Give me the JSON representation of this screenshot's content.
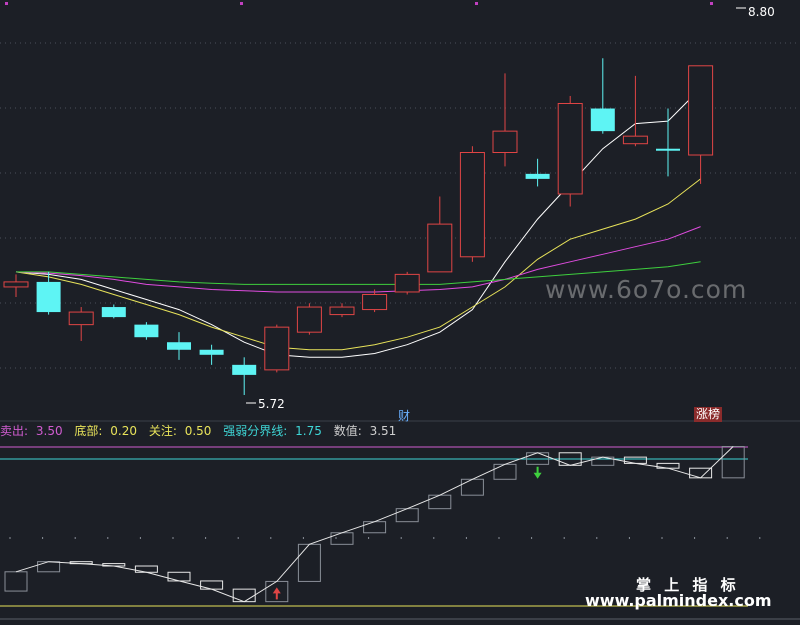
{
  "chart_data": [
    {
      "type": "candlestick",
      "price_labels": {
        "high": "8.80",
        "low": "5.72"
      },
      "candles": [
        {
          "o": 6.62,
          "c": 6.58,
          "h": 6.68,
          "l": 6.5,
          "color": "red"
        },
        {
          "o": 6.62,
          "c": 6.38,
          "h": 6.7,
          "l": 6.36,
          "color": "cyan"
        },
        {
          "o": 6.38,
          "c": 6.28,
          "h": 6.42,
          "l": 6.15,
          "color": "red"
        },
        {
          "o": 6.42,
          "c": 6.34,
          "h": 6.44,
          "l": 6.33,
          "color": "cyan"
        },
        {
          "o": 6.28,
          "c": 6.18,
          "h": 6.3,
          "l": 6.16,
          "color": "cyan"
        },
        {
          "o": 6.14,
          "c": 6.08,
          "h": 6.22,
          "l": 6.0,
          "color": "cyan"
        },
        {
          "o": 6.08,
          "c": 6.04,
          "h": 6.12,
          "l": 5.96,
          "color": "cyan"
        },
        {
          "o": 5.96,
          "c": 5.88,
          "h": 6.02,
          "l": 5.72,
          "color": "cyan"
        },
        {
          "o": 5.92,
          "c": 6.26,
          "h": 6.28,
          "l": 5.9,
          "color": "red"
        },
        {
          "o": 6.22,
          "c": 6.42,
          "h": 6.45,
          "l": 6.2,
          "color": "red"
        },
        {
          "o": 6.36,
          "c": 6.42,
          "h": 6.45,
          "l": 6.34,
          "color": "red"
        },
        {
          "o": 6.4,
          "c": 6.52,
          "h": 6.56,
          "l": 6.38,
          "color": "red"
        },
        {
          "o": 6.54,
          "c": 6.68,
          "h": 6.7,
          "l": 6.52,
          "color": "red"
        },
        {
          "o": 6.7,
          "c": 7.08,
          "h": 7.3,
          "l": 6.7,
          "color": "red"
        },
        {
          "o": 6.82,
          "c": 7.65,
          "h": 7.7,
          "l": 6.78,
          "color": "red"
        },
        {
          "o": 7.65,
          "c": 7.82,
          "h": 8.28,
          "l": 7.54,
          "color": "red"
        },
        {
          "o": 7.48,
          "c": 7.44,
          "h": 7.6,
          "l": 7.38,
          "color": "cyan"
        },
        {
          "o": 7.32,
          "c": 8.04,
          "h": 8.1,
          "l": 7.22,
          "color": "red"
        },
        {
          "o": 8.0,
          "c": 7.82,
          "h": 8.4,
          "l": 7.8,
          "color": "cyan"
        },
        {
          "o": 7.72,
          "c": 7.78,
          "h": 8.26,
          "l": 7.7,
          "color": "red"
        },
        {
          "o": 7.68,
          "c": 7.68,
          "h": 8.0,
          "l": 7.46,
          "color": "cyan"
        },
        {
          "o": 7.63,
          "c": 8.34,
          "h": 8.34,
          "l": 7.4,
          "color": "red"
        }
      ],
      "ma_lines": [
        {
          "color": "#ffffff",
          "values": [
            6.7,
            6.68,
            6.64,
            6.56,
            6.48,
            6.4,
            6.28,
            6.14,
            6.04,
            6.02,
            6.02,
            6.05,
            6.12,
            6.22,
            6.4,
            6.78,
            7.12,
            7.4,
            7.68,
            7.88,
            7.9,
            8.16
          ]
        },
        {
          "color": "#e8e35a",
          "values": [
            6.7,
            6.66,
            6.6,
            6.52,
            6.44,
            6.36,
            6.26,
            6.18,
            6.1,
            6.08,
            6.08,
            6.12,
            6.18,
            6.26,
            6.42,
            6.58,
            6.8,
            6.96,
            7.04,
            7.12,
            7.24,
            7.44
          ]
        },
        {
          "color": "#e04ce0",
          "values": [
            6.7,
            6.69,
            6.67,
            6.64,
            6.6,
            6.58,
            6.56,
            6.55,
            6.54,
            6.54,
            6.54,
            6.54,
            6.55,
            6.56,
            6.58,
            6.64,
            6.72,
            6.78,
            6.84,
            6.9,
            6.96,
            7.06
          ]
        },
        {
          "color": "#3ecf3e",
          "values": [
            6.7,
            6.7,
            6.68,
            6.66,
            6.64,
            6.62,
            6.61,
            6.6,
            6.6,
            6.6,
            6.6,
            6.6,
            6.6,
            6.6,
            6.62,
            6.64,
            6.66,
            6.68,
            6.7,
            6.72,
            6.74,
            6.78
          ]
        }
      ],
      "markers": {
        "cai": "财",
        "zhang": "涨榜"
      }
    },
    {
      "type": "indicator",
      "legend": [
        {
          "label": "卖出:",
          "value": "3.50",
          "color": "#d05cd0"
        },
        {
          "label": "底部:",
          "value": "0.20",
          "color": "#e8e35a"
        },
        {
          "label": "关注:",
          "value": "0.50",
          "color": "#e8e35a"
        },
        {
          "label": "强弱分界线:",
          "value": "1.75",
          "color": "#3ed6d6"
        },
        {
          "label": "数值:",
          "value": "3.51",
          "color": "#cfcfcf"
        }
      ],
      "levels": {
        "sell": 3.5,
        "bottom": 0.2,
        "focus": 0.5,
        "divide": 3.25
      },
      "values": [
        0.91,
        1.12,
        1.08,
        1.03,
        0.9,
        0.72,
        0.55,
        0.29,
        0.71,
        1.48,
        1.72,
        1.95,
        2.22,
        2.5,
        2.83,
        3.14,
        3.38,
        3.12,
        3.29,
        3.16,
        3.06,
        2.86,
        3.51
      ],
      "arrows": {
        "up_index": 8,
        "down_index": 16
      }
    }
  ],
  "watermark": {
    "site": "www.6o7o.com",
    "cn": "掌 上 指 标",
    "site2": "www.palmindex.com"
  }
}
